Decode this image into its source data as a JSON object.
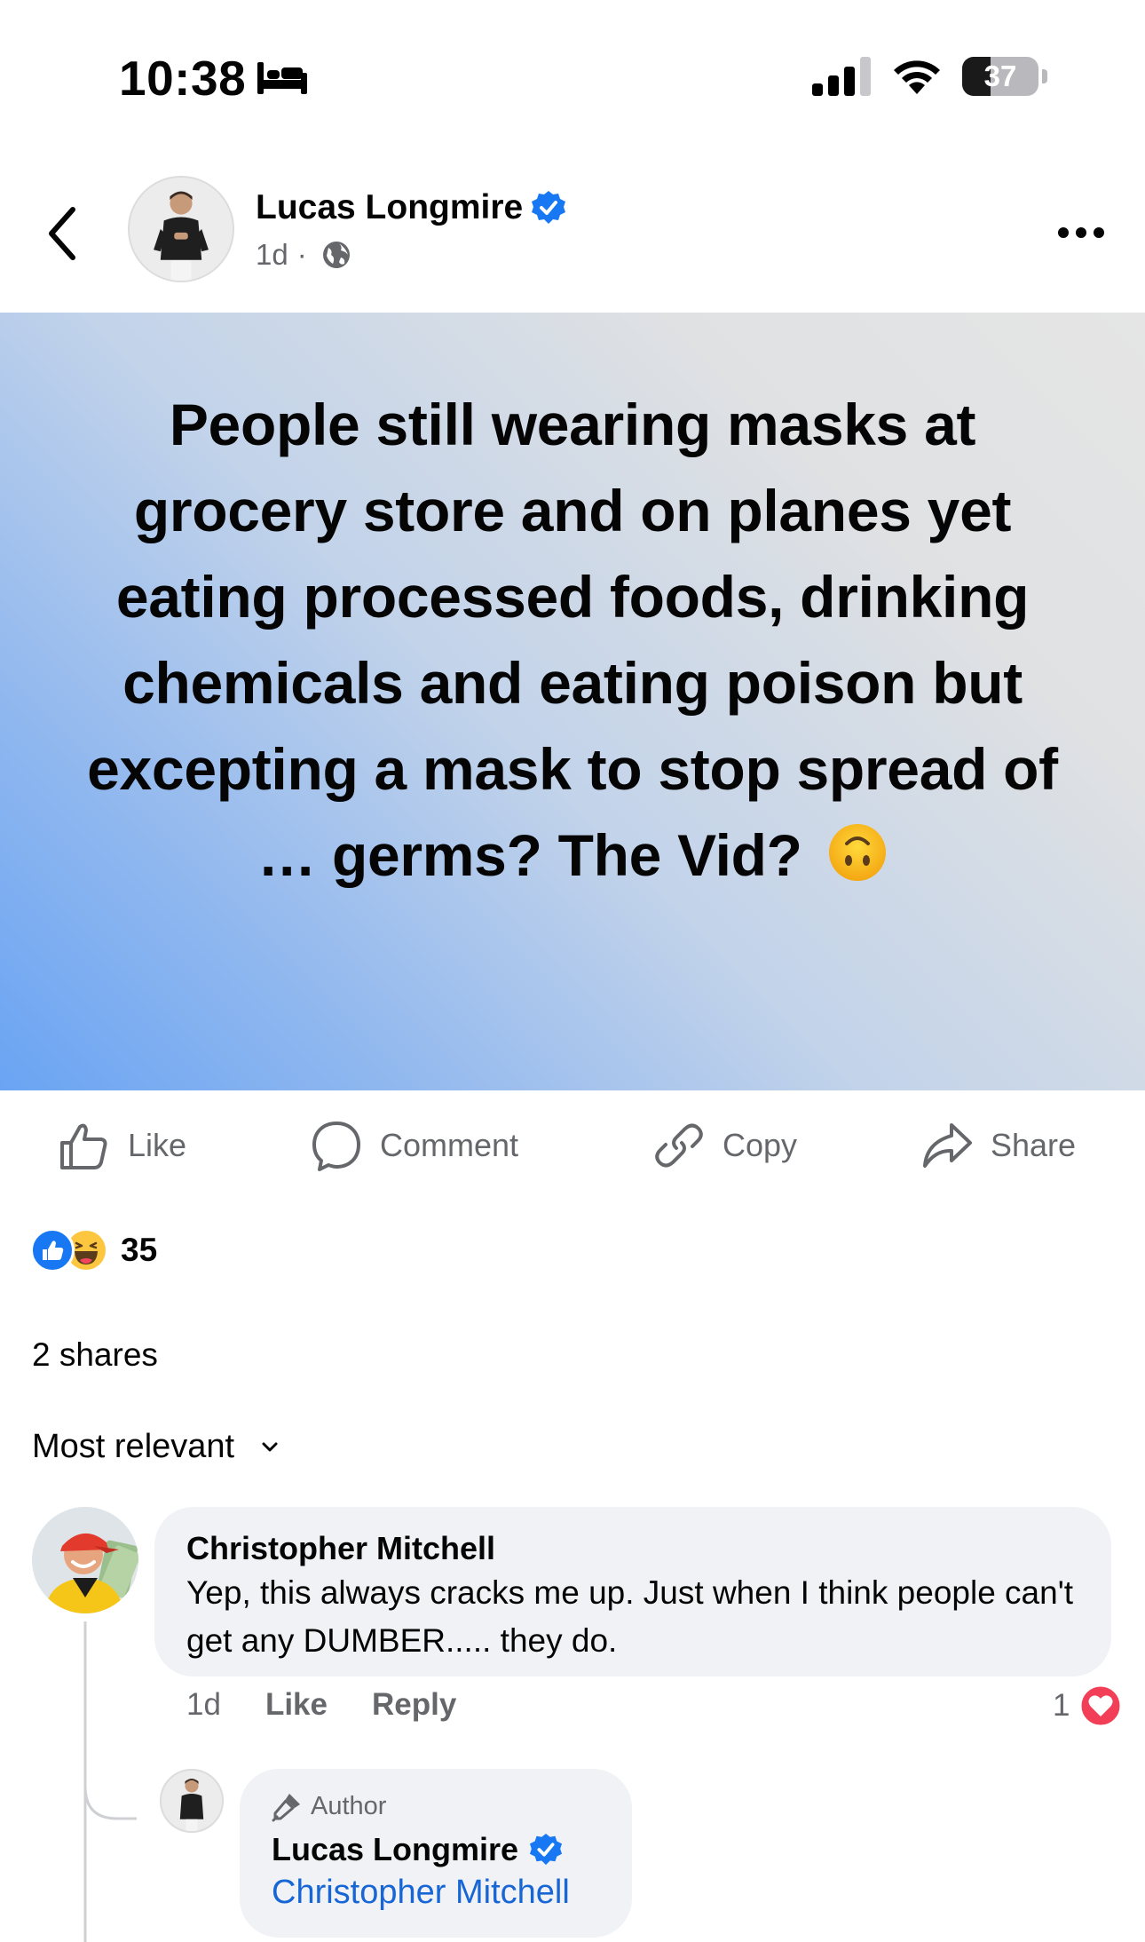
{
  "status_bar": {
    "time": "10:38",
    "battery_level": "37",
    "icons": [
      "bed-icon",
      "cellular-signal-icon",
      "wifi-icon",
      "battery-icon"
    ]
  },
  "post": {
    "author": "Lucas Longmire",
    "age": "1d",
    "meta_separator": "·",
    "audience_icon": "globe-icon",
    "text": "People still wearing masks at grocery store and on planes yet eating processed foods, drinking chemicals and eating poison but excepting a mask to stop spread of … germs? The Vid?",
    "emoji": "upside-down-face",
    "background_colors": [
      "#e5e5e5",
      "#6aa4f3"
    ]
  },
  "actions": {
    "like": "Like",
    "comment": "Comment",
    "copy": "Copy",
    "share": "Share"
  },
  "reactions": {
    "types": [
      "like",
      "haha"
    ],
    "count": "35"
  },
  "shares": "2 shares",
  "sort_label": "Most relevant",
  "comments": [
    {
      "author": "Christopher Mitchell",
      "text": "Yep, this always cracks me up. Just when I think people can't get any DUMBER..... they do.",
      "age": "1d",
      "like_label": "Like",
      "reply_label": "Reply",
      "reaction_count": "1",
      "reaction_type": "love",
      "replies": [
        {
          "badge": "Author",
          "author": "Lucas Longmire",
          "mention": "Christopher Mitchell"
        }
      ]
    }
  ],
  "colors": {
    "facebook_blue": "#1877f2",
    "mention_blue": "#1866d6",
    "secondary_text": "#65676b",
    "bubble_bg": "#f0f2f5",
    "love_red": "#f33e58"
  }
}
